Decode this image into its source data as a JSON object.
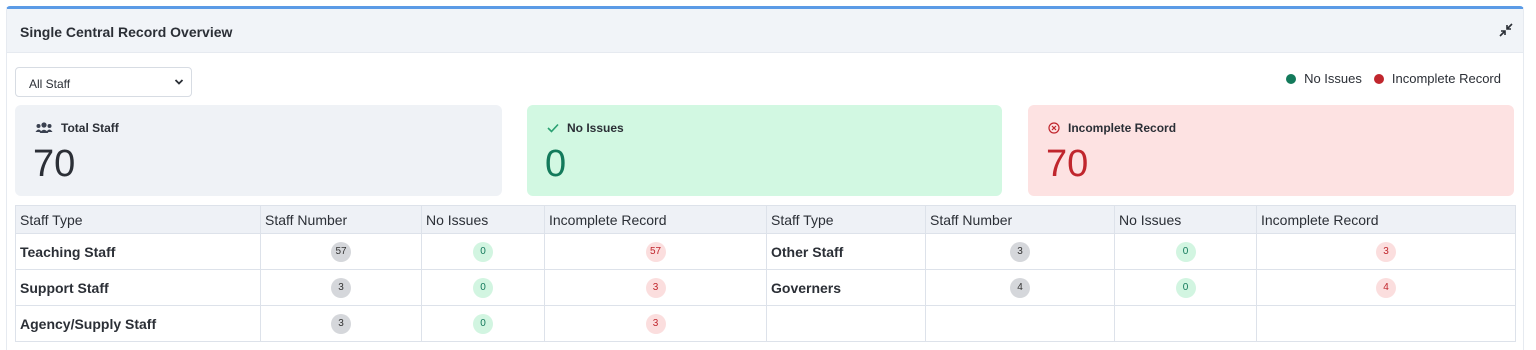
{
  "panel": {
    "title": "Single Central Record Overview"
  },
  "filter": {
    "selected": "All Staff"
  },
  "legend": [
    {
      "label": "No Issues",
      "color": "#137a5b"
    },
    {
      "label": "Incomplete Record",
      "color": "#c0262d"
    }
  ],
  "cards": {
    "total": {
      "label": "Total Staff",
      "value": "70"
    },
    "no_issues": {
      "label": "No Issues",
      "value": "0"
    },
    "incomplete": {
      "label": "Incomplete Record",
      "value": "70"
    }
  },
  "table": {
    "headers": [
      "Staff Type",
      "Staff Number",
      "No Issues",
      "Incomplete Record",
      "Staff Type",
      "Staff Number",
      "No Issues",
      "Incomplete Record"
    ],
    "left_rows": [
      {
        "type": "Teaching Staff",
        "number": "57",
        "no_issues": "0",
        "incomplete": "57"
      },
      {
        "type": "Support Staff",
        "number": "3",
        "no_issues": "0",
        "incomplete": "3"
      },
      {
        "type": "Agency/Supply Staff",
        "number": "3",
        "no_issues": "0",
        "incomplete": "3"
      }
    ],
    "right_rows": [
      {
        "type": "Other Staff",
        "number": "3",
        "no_issues": "0",
        "incomplete": "3"
      },
      {
        "type": "Governers",
        "number": "4",
        "no_issues": "0",
        "incomplete": "4"
      }
    ]
  }
}
